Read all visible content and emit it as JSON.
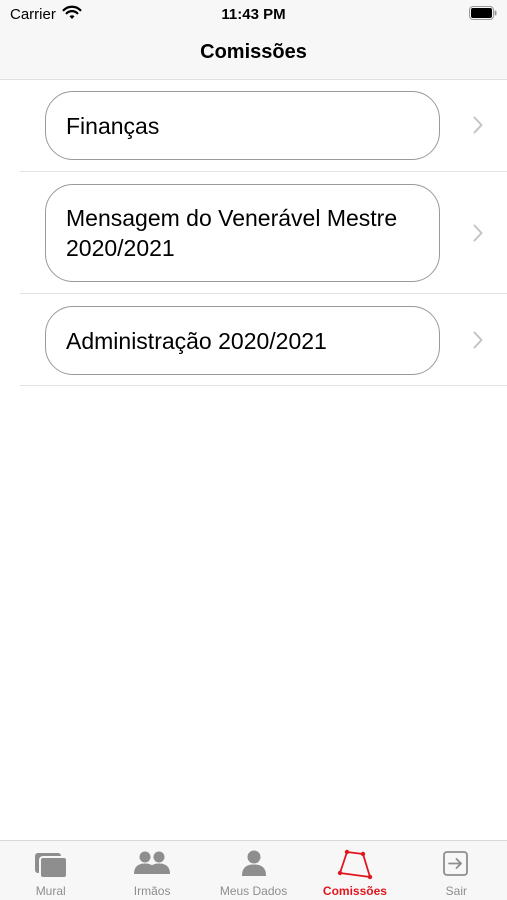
{
  "status_bar": {
    "carrier": "Carrier",
    "time": "11:43 PM"
  },
  "header": {
    "title": "Comissões"
  },
  "commissions": [
    {
      "label": "Finanças"
    },
    {
      "label": "Mensagem do Venerável Mestre 2020/2021"
    },
    {
      "label": "Administração 2020/2021"
    }
  ],
  "tab_bar": {
    "active_color": "#e0161f",
    "inactive_color": "#8e8e8e",
    "tabs": [
      {
        "label": "Mural",
        "icon": "cards-icon"
      },
      {
        "label": "Irmãos",
        "icon": "people-icon"
      },
      {
        "label": "Meus Dados",
        "icon": "person-icon"
      },
      {
        "label": "Comissões",
        "icon": "compass-square-icon",
        "active": true
      },
      {
        "label": "Sair",
        "icon": "exit-icon"
      }
    ]
  }
}
